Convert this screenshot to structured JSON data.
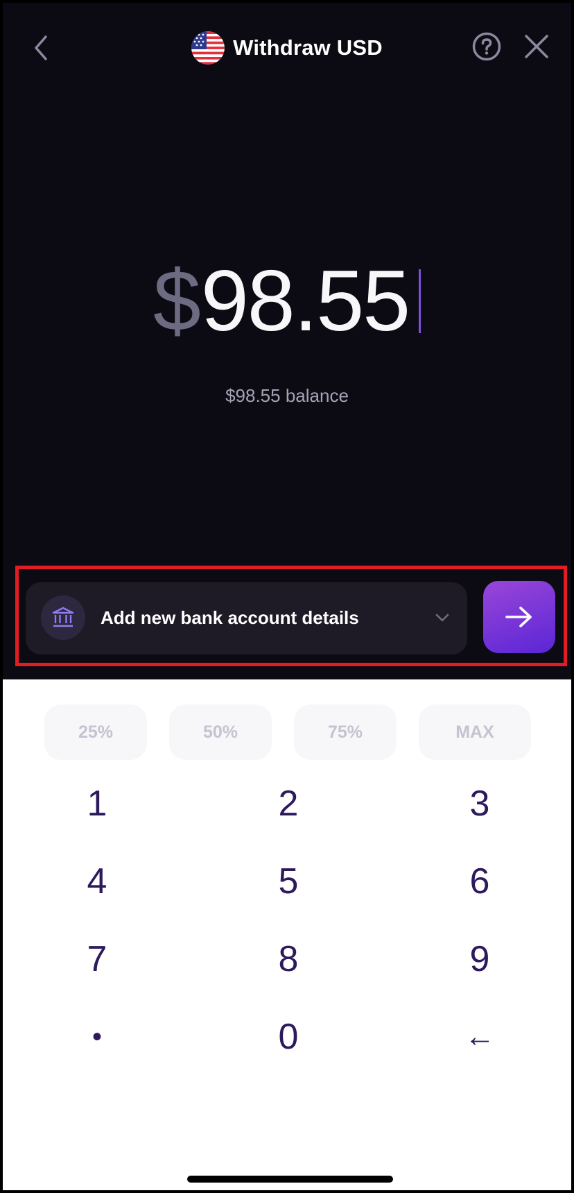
{
  "header": {
    "title": "Withdraw USD",
    "back_icon": "chevron-left-icon",
    "help_icon": "question-circle-icon",
    "close_icon": "close-icon",
    "flag_icon": "us-flag-icon"
  },
  "amount": {
    "currency_symbol": "$",
    "value": "98.55",
    "balance_text": "$98.55 balance"
  },
  "bank_selector": {
    "label": "Add new bank account details",
    "icon": "bank-icon",
    "dropdown_icon": "chevron-down-icon",
    "next_icon": "arrow-right-icon"
  },
  "percent_buttons": [
    "25%",
    "50%",
    "75%",
    "MAX"
  ],
  "keypad": {
    "keys": [
      "1",
      "2",
      "3",
      "4",
      "5",
      "6",
      "7",
      "8",
      "9",
      "•",
      "0",
      "←"
    ]
  },
  "colors": {
    "background_dark": "#0c0a12",
    "accent_purple": "#5a26d6",
    "key_text": "#2d1a5c",
    "highlight_border": "#e31b23"
  }
}
